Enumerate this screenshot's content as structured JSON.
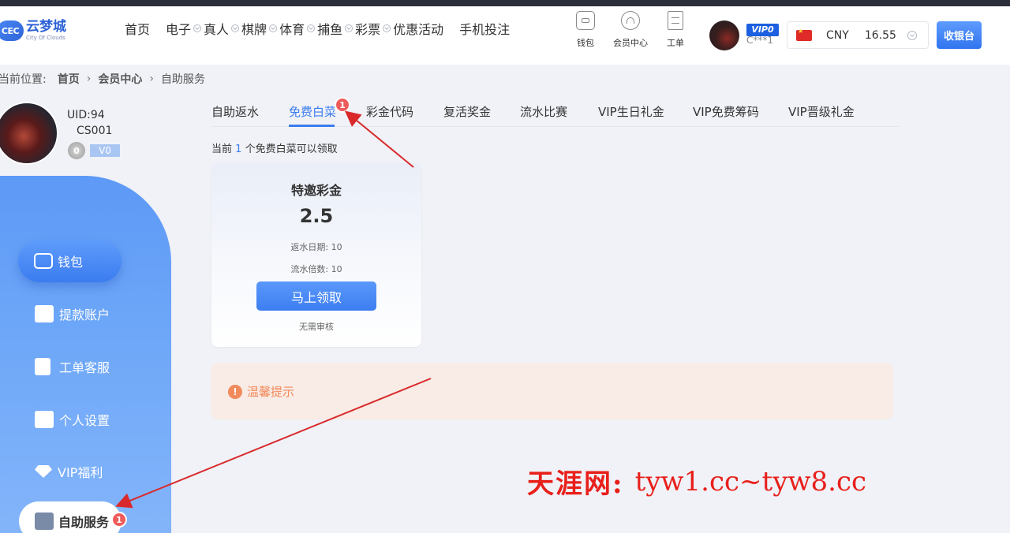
{
  "header": {
    "logo": {
      "badge": "CEC",
      "name": "云梦城",
      "subtitle": "City Of Clouds"
    },
    "nav": [
      {
        "label": "首页",
        "has_dropdown": false
      },
      {
        "label": "电子",
        "has_dropdown": true
      },
      {
        "label": "真人",
        "has_dropdown": true
      },
      {
        "label": "棋牌",
        "has_dropdown": true
      },
      {
        "label": "体育",
        "has_dropdown": true
      },
      {
        "label": "捕鱼",
        "has_dropdown": true
      },
      {
        "label": "彩票",
        "has_dropdown": true
      },
      {
        "label": "优惠活动",
        "has_dropdown": false
      },
      {
        "label": "手机投注",
        "has_dropdown": false
      }
    ],
    "icons": [
      {
        "label": "钱包",
        "icon": "wallet-icon"
      },
      {
        "label": "会员中心",
        "icon": "headset-icon"
      },
      {
        "label": "工单",
        "icon": "ticket-icon"
      }
    ],
    "user": {
      "vip": "VIP0",
      "name": "C***1"
    },
    "currency": {
      "code": "CNY",
      "balance": "16.55"
    },
    "cashier_label": "收银台"
  },
  "breadcrumb": {
    "prefix": "当前位置:",
    "items": [
      "首页",
      "会员中心",
      "自助服务"
    ]
  },
  "profile": {
    "uid": "UID:94",
    "username": "CS001",
    "level": "V0",
    "level_icon": "0"
  },
  "sidebar": {
    "active": "钱包",
    "items": [
      "提款账户",
      "工单客服",
      "个人设置",
      "VIP福利"
    ],
    "selected": "自助服务",
    "selected_badge": "1"
  },
  "tabs": {
    "items": [
      "自助返水",
      "免费白菜",
      "彩金代码",
      "复活奖金",
      "流水比赛",
      "VIP生日礼金",
      "VIP免费筹码",
      "VIP晋级礼金"
    ],
    "active_index": 1,
    "badge": "1"
  },
  "content": {
    "available_prefix": "当前",
    "available_count": "1",
    "available_suffix": "个免费白菜可以领取",
    "card": {
      "title": "特邀彩金",
      "amount": "2.5",
      "rebate_days": "返水日期: 10",
      "turnover": "流水倍数: 10",
      "button": "马上领取",
      "note": "无需审核"
    },
    "tip": "温馨提示"
  },
  "watermark": {
    "cn": "天涯网:",
    "url": "tyw1.cc~tyw8.cc"
  },
  "colors": {
    "accent": "#3b7cf0",
    "badge": "#ef5b5b",
    "tip": "#f28a5b",
    "watermark": "#e8201b"
  }
}
